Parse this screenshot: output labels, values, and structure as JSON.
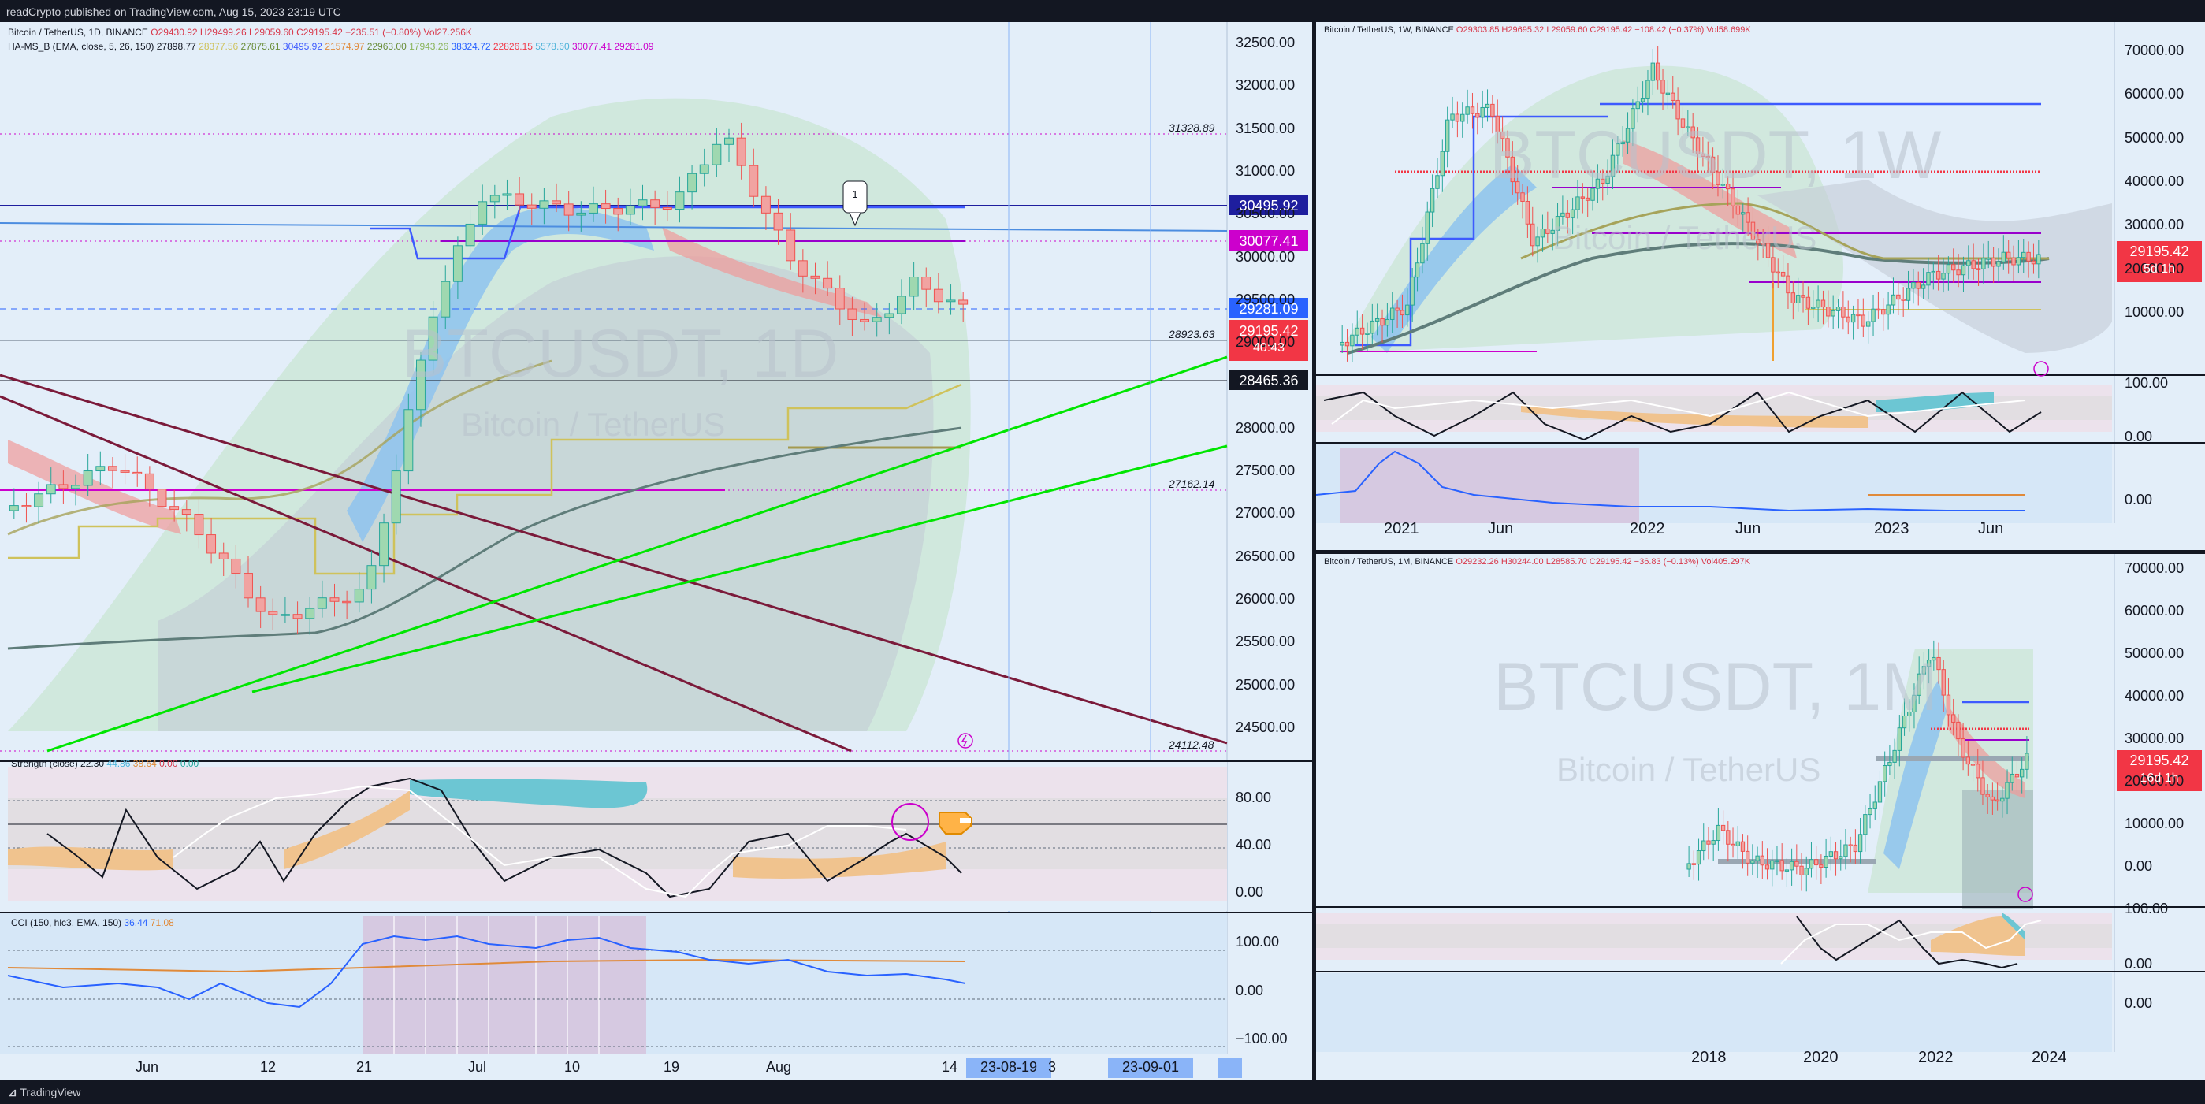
{
  "app": {
    "title": "readCrypto published on TradingView.com, Aug 15, 2023 23:19 UTC",
    "brand": "TradingView"
  },
  "colors": {
    "accent": "#2962ff",
    "bull": "#26a69a",
    "bear": "#ef5350",
    "magenta": "#cc00cc",
    "lime": "#00ff00",
    "maroon": "#7b1a3a"
  },
  "daily": {
    "symbol_line": "Bitcoin / TetherUS, 1D, BINANCE",
    "ohlc": {
      "o": "O29430.92",
      "h": "H29499.26",
      "l": "L29059.60",
      "c": "C29195.42",
      "chg": "−235.51 (−0.80%)",
      "vol": "Vol27.256K"
    },
    "indicator_name": "HA-MS_B (EMA, close, 5, 26, 150)",
    "indicator_values": [
      "27898.77",
      "28377.56",
      "27875.61",
      "30495.92",
      "21574.97",
      "22963.00",
      "17943.26",
      "38324.72",
      "22826.15",
      "5578.60",
      "30077.41",
      "29281.09"
    ],
    "watermark_main": "BTCUSDT, 1D",
    "watermark_sub": "Bitcoin / TetherUS",
    "price_axis": [
      "32500.00",
      "32000.00",
      "31500.00",
      "31000.00",
      "30500.00",
      "30000.00",
      "29500.00",
      "29000.00",
      "28500.00",
      "28000.00",
      "27500.00",
      "27000.00",
      "26500.00",
      "26000.00",
      "25500.00",
      "25000.00",
      "24500.00"
    ],
    "level_labels": [
      "31328.89",
      "28923.63",
      "27162.14",
      "24112.48"
    ],
    "price_tags": {
      "blue": "30495.92",
      "magenta": "30077.41",
      "blue2": "29281.09",
      "red": "29195.42",
      "red_sub": "40:43",
      "dark": "28465.36"
    },
    "callout": "1",
    "strength": {
      "label": "Strength (close)",
      "values": [
        "22.30",
        "44.86",
        "38.64",
        "0.00",
        "0.00"
      ],
      "axis": [
        "80.00",
        "40.00",
        "0.00"
      ]
    },
    "cci": {
      "label": "CCI (150, hlc3, EMA, 150)",
      "values": [
        "36.44",
        "71.08"
      ],
      "axis": [
        "100.00",
        "0.00",
        "−100.00"
      ]
    },
    "time_axis": [
      "Jun",
      "12",
      "21",
      "Jul",
      "10",
      "19",
      "Aug",
      "14",
      "3"
    ],
    "time_tags": [
      "23-08-19",
      "23-09-01"
    ]
  },
  "weekly": {
    "symbol_line": "Bitcoin / TetherUS, 1W, BINANCE",
    "ohlc": {
      "o": "O29303.85",
      "h": "H29695.32",
      "l": "L29059.60",
      "c": "C29195.42",
      "chg": "−108.42 (−0.37%)",
      "vol": "Vol58.699K"
    },
    "watermark_main": "BTCUSDT, 1W",
    "watermark_sub": "Bitcoin / TetherUS",
    "price_axis": [
      "70000.00",
      "60000.00",
      "50000.00",
      "40000.00",
      "30000.00",
      "20000.00",
      "10000.00"
    ],
    "price_tag": "29195.42",
    "price_tag_sub": "5d 1h",
    "osc_axis": [
      "100.00",
      "0.00"
    ],
    "cci_axis": [
      "0.00"
    ],
    "time_axis": [
      "2021",
      "Jun",
      "2022",
      "Jun",
      "2023",
      "Jun"
    ]
  },
  "monthly": {
    "symbol_line": "Bitcoin / TetherUS, 1M, BINANCE",
    "ohlc": {
      "o": "O29232.26",
      "h": "H30244.00",
      "l": "L28585.70",
      "c": "C29195.42",
      "chg": "−36.83 (−0.13%)",
      "vol": "Vol405.297K"
    },
    "watermark_main": "BTCUSDT, 1M",
    "watermark_sub": "Bitcoin / TetherUS",
    "price_axis": [
      "70000.00",
      "60000.00",
      "50000.00",
      "40000.00",
      "30000.00",
      "20000.00",
      "10000.00",
      "0.00"
    ],
    "price_tag": "29195.42",
    "price_tag_sub": "16d 1h",
    "osc_axis": [
      "100.00",
      "0.00"
    ],
    "cci_axis": [
      "0.00"
    ],
    "time_axis": [
      "2018",
      "2020",
      "2022",
      "2024"
    ]
  }
}
